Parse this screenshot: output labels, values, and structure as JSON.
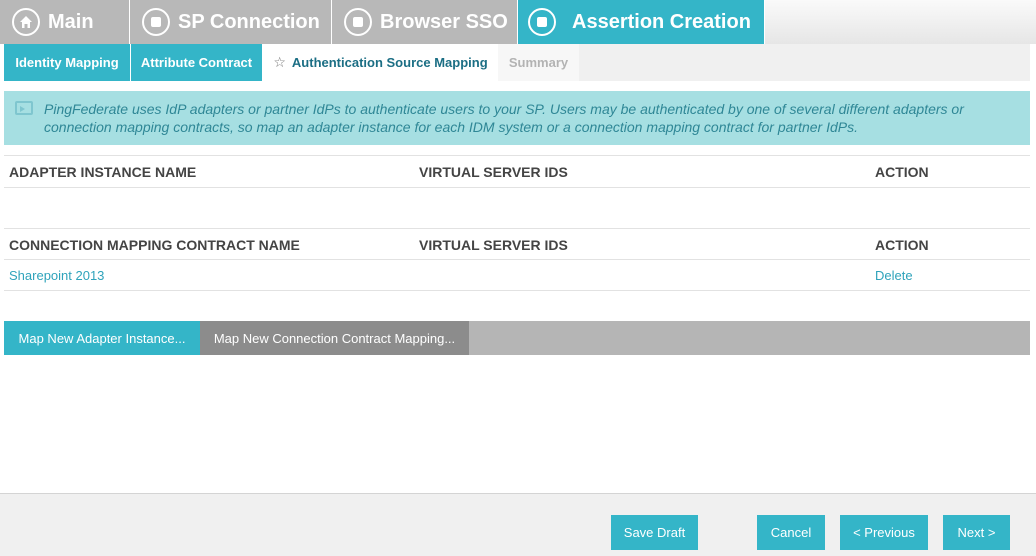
{
  "main_tabs": [
    {
      "label": "Main",
      "icon": "home-icon",
      "active": false
    },
    {
      "label": "SP Connection",
      "icon": "step-icon",
      "active": false
    },
    {
      "label": "Browser SSO",
      "icon": "step-icon",
      "active": false
    },
    {
      "label": "Assertion Creation",
      "icon": "step-icon",
      "active": true
    }
  ],
  "sub_tabs": [
    {
      "label": "Identity Mapping",
      "state": "done"
    },
    {
      "label": "Attribute Contract",
      "state": "done"
    },
    {
      "label": "Authentication Source Mapping",
      "state": "current"
    },
    {
      "label": "Summary",
      "state": "pending"
    }
  ],
  "info": {
    "text": "PingFederate uses IdP adapters or partner IdPs to authenticate users to your SP. Users may be authenticated by one of several different adapters or connection mapping contracts, so map an adapter instance for each IDM system or a connection mapping contract for partner IdPs."
  },
  "adapter_table": {
    "headers": [
      "ADAPTER INSTANCE NAME",
      "VIRTUAL SERVER IDS",
      "ACTION"
    ],
    "rows": []
  },
  "connection_table": {
    "headers": [
      "CONNECTION MAPPING CONTRACT NAME",
      "VIRTUAL SERVER IDS",
      "ACTION"
    ],
    "rows": [
      {
        "name": "Sharepoint 2013",
        "virtual_server_ids": "",
        "action": "Delete"
      }
    ]
  },
  "actions": {
    "map_adapter": "Map New Adapter Instance...",
    "map_connection": "Map New Connection Contract Mapping..."
  },
  "footer": {
    "save_draft": "Save Draft",
    "cancel": "Cancel",
    "previous": "< Previous",
    "next": "Next >"
  },
  "colors": {
    "accent": "#34b5c8",
    "inactive_tab": "#b8b8b8",
    "info_bg": "#a6dfe2",
    "link": "#2fa3bb"
  }
}
